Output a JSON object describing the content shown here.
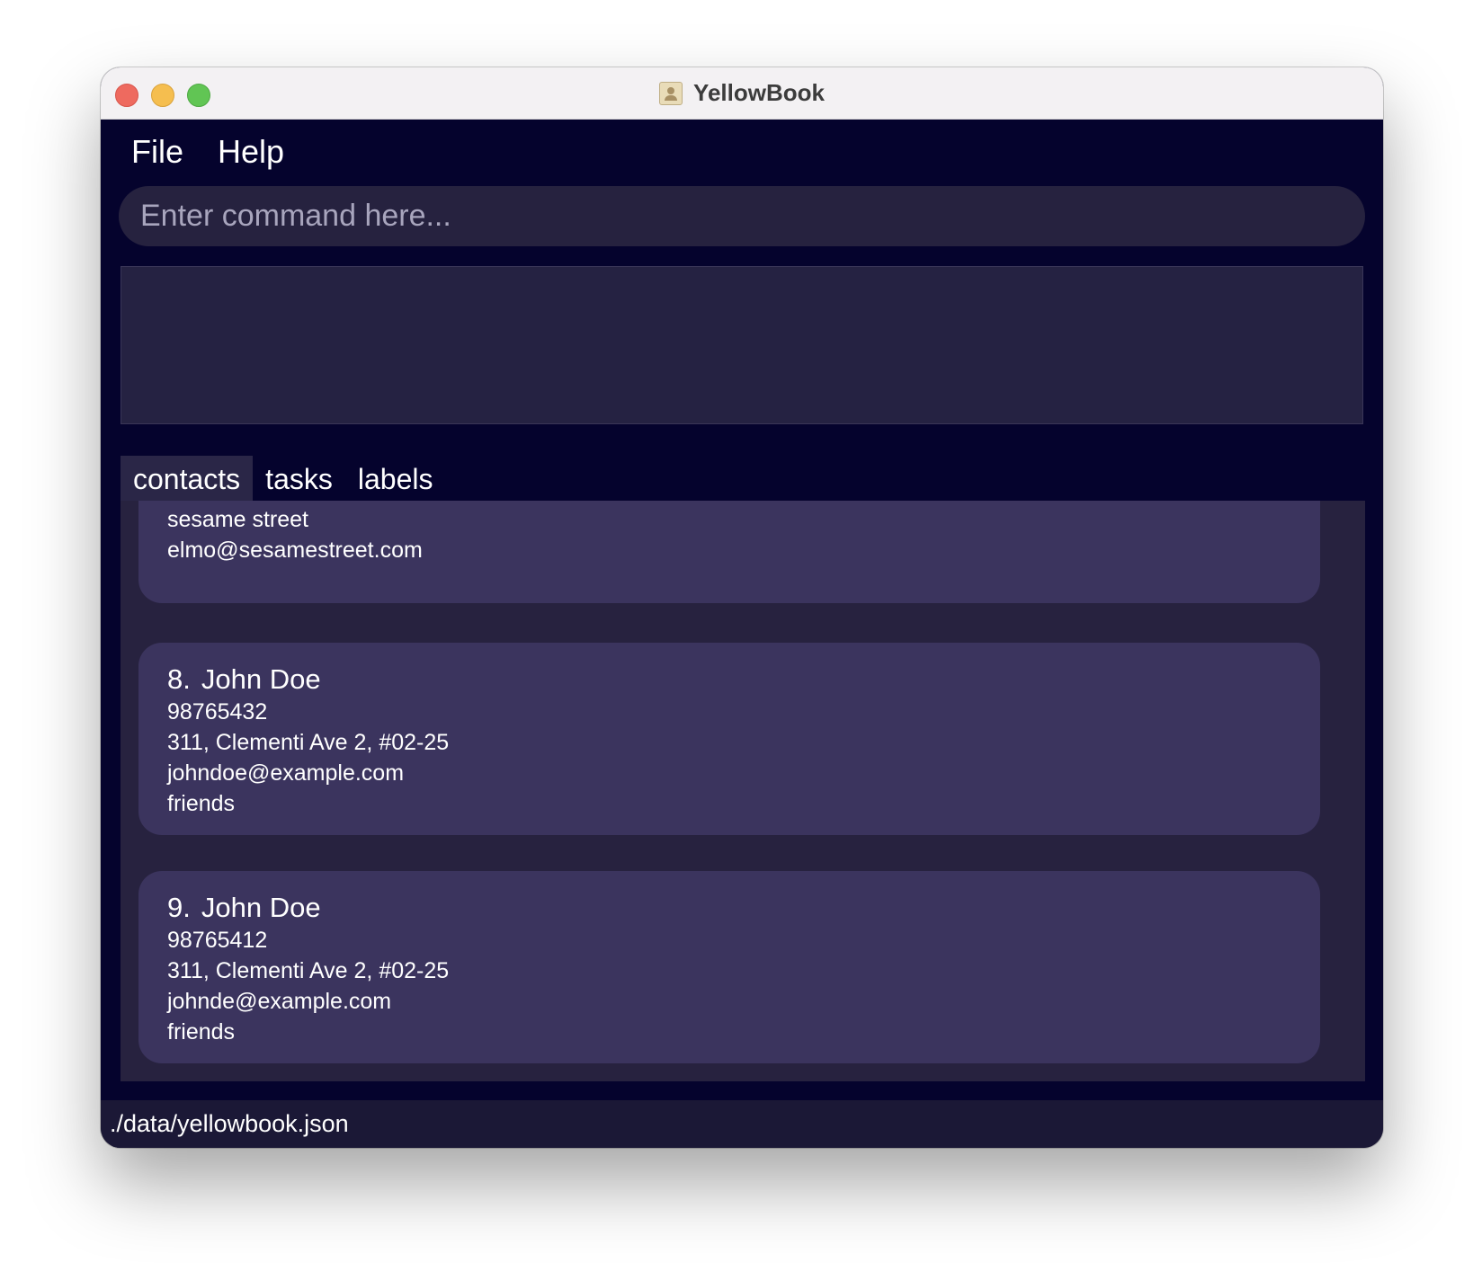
{
  "window": {
    "title": "YellowBook",
    "icon": "address-book-icon"
  },
  "menu": {
    "items": [
      {
        "label": "File"
      },
      {
        "label": "Help"
      }
    ]
  },
  "command": {
    "placeholder": "Enter command here...",
    "value": ""
  },
  "result": {
    "text": ""
  },
  "tabs": [
    {
      "label": "contacts",
      "active": true
    },
    {
      "label": "tasks",
      "active": false
    },
    {
      "label": "labels",
      "active": false
    }
  ],
  "contacts": [
    {
      "address": "sesame street",
      "email": "elmo@sesamestreet.com"
    },
    {
      "index": "8.",
      "name": "John Doe",
      "phone": "98765432",
      "address": "311, Clementi Ave 2, #02-25",
      "email": "johndoe@example.com",
      "label": "friends"
    },
    {
      "index": "9.",
      "name": "John Doe",
      "phone": "98765412",
      "address": "311, Clementi Ave 2, #02-25",
      "email": "johnde@example.com",
      "label": "friends"
    }
  ],
  "status": {
    "file_path": "./data/yellowbook.json"
  },
  "colors": {
    "background": "#05032d",
    "card": "#3b345e",
    "panel": "#27223f"
  }
}
